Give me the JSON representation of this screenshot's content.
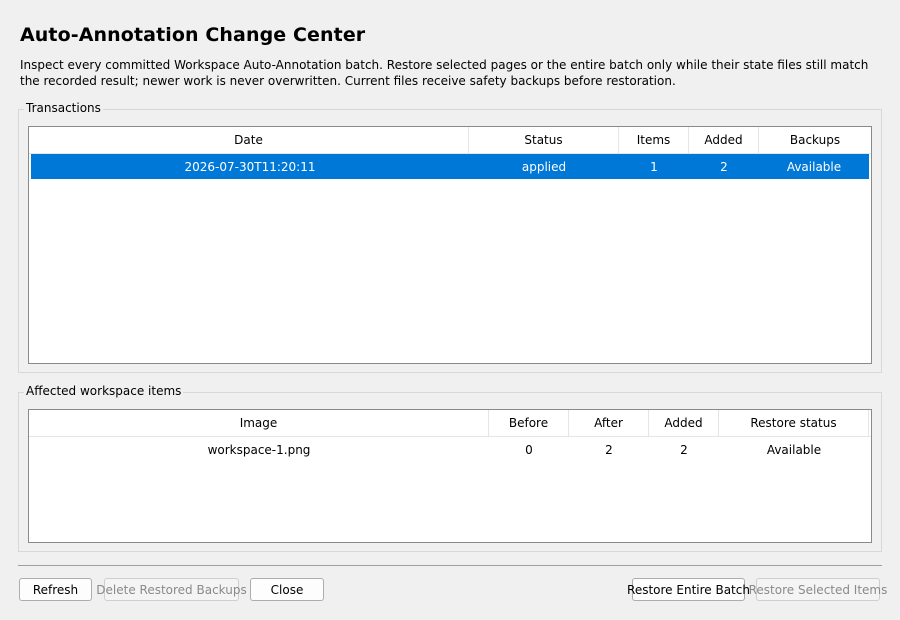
{
  "window": {
    "title": "Auto-Annotation Change Center",
    "description": "Inspect every committed Workspace Auto-Annotation batch. Restore selected pages or the entire batch only while their state files still match the recorded result; newer work is never overwritten. Current files receive safety backups before restoration."
  },
  "transactions": {
    "label": "Transactions",
    "columns": [
      "Date",
      "Status",
      "Items",
      "Added",
      "Backups"
    ],
    "rows": [
      {
        "date": "2026-07-30T11:20:11",
        "status": "applied",
        "items": "1",
        "added": "2",
        "backups": "Available",
        "selected": true
      }
    ]
  },
  "affected": {
    "label": "Affected workspace items",
    "columns": [
      "Image",
      "Before",
      "After",
      "Added",
      "Restore status"
    ],
    "rows": [
      {
        "image": "workspace-1.png",
        "before": "0",
        "after": "2",
        "added": "2",
        "restore_status": "Available"
      }
    ]
  },
  "buttons": {
    "refresh": "Refresh",
    "delete_restored_backups": "Delete Restored Backups",
    "close": "Close",
    "restore_entire_batch": "Restore Entire Batch",
    "restore_selected_items": "Restore Selected Items"
  },
  "colors": {
    "selection": "#0078d7",
    "window_bg": "#f0f0f0"
  }
}
